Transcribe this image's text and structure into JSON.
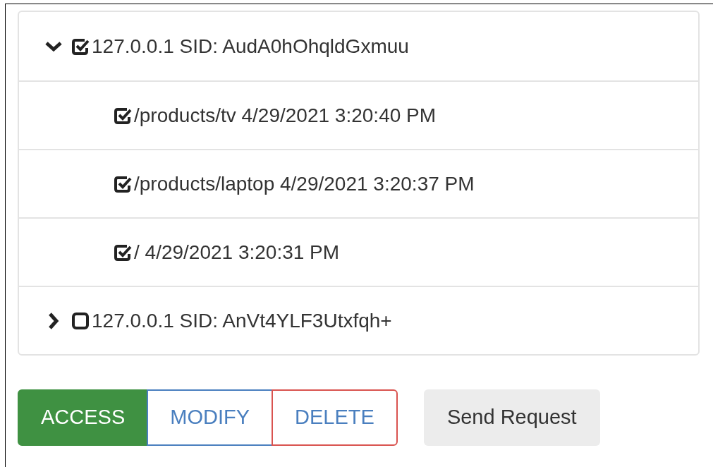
{
  "tree": [
    {
      "label": "127.0.0.1 SID: AudA0hOhqldGxmuu",
      "expanded": true,
      "checked": true,
      "children": [
        {
          "label": "/products/tv 4/29/2021 3:20:40 PM",
          "checked": true
        },
        {
          "label": "/products/laptop 4/29/2021 3:20:37 PM",
          "checked": true
        },
        {
          "label": "/ 4/29/2021 3:20:31 PM",
          "checked": true
        }
      ]
    },
    {
      "label": "127.0.0.1 SID: AnVt4YLF3Utxfqh+",
      "expanded": false,
      "checked": false
    }
  ],
  "modes": [
    {
      "label": "ACCESS",
      "selected": true,
      "color": "#3f9142"
    },
    {
      "label": "MODIFY",
      "selected": false,
      "color": "#4a7fbf"
    },
    {
      "label": "DELETE",
      "selected": false,
      "color": "#d9534f"
    }
  ],
  "send_button": {
    "label": "Send Request"
  }
}
